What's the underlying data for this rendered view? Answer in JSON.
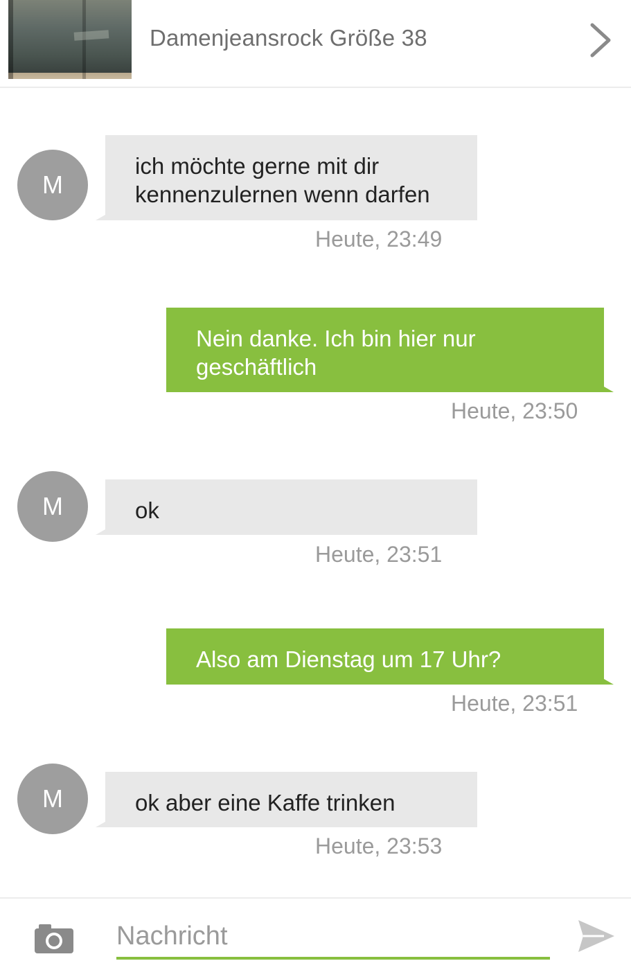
{
  "header": {
    "item_title": "Damenjeansrock Größe 38",
    "thumbnail_icon": "product-thumbnail",
    "chevron_icon": "chevron-right-icon"
  },
  "messages": [
    {
      "direction": "incoming",
      "avatar": "M",
      "lines": [
        "ich möchte gerne mit dir",
        "kennenzulernen wenn darfen"
      ],
      "time": "Heute, 23:49"
    },
    {
      "direction": "outgoing",
      "lines": [
        "Nein danke. Ich bin hier nur",
        "geschäftlich"
      ],
      "time": "Heute, 23:50"
    },
    {
      "direction": "incoming",
      "avatar": "M",
      "lines": [
        "ok"
      ],
      "time": "Heute, 23:51"
    },
    {
      "direction": "outgoing",
      "lines": [
        "Also am Dienstag um 17 Uhr?"
      ],
      "time": "Heute, 23:51"
    },
    {
      "direction": "incoming",
      "avatar": "M",
      "lines": [
        "ok aber eine Kaffe trinken"
      ],
      "time": "Heute, 23:53"
    }
  ],
  "composer": {
    "placeholder": "Nachricht",
    "camera_icon": "camera-icon",
    "send_icon": "send-icon"
  },
  "colors": {
    "outgoing_bubble": "#88bf3f",
    "incoming_bubble": "#e8e8e8",
    "avatar": "#9e9e9e",
    "timestamp": "#9a9a9a"
  }
}
